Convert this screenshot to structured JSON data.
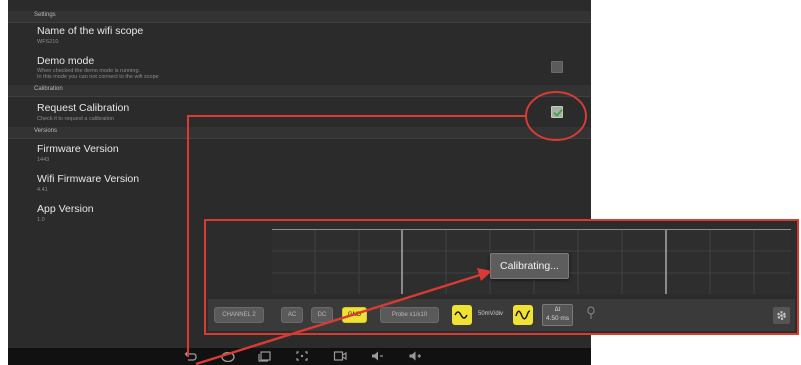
{
  "settings": {
    "sections": {
      "settings": "Settings",
      "calibration": "Calibration",
      "versions": "Versions"
    },
    "items": {
      "wifi_scope_name": {
        "title": "Name of the wifi scope",
        "value": "WFS210"
      },
      "demo_mode": {
        "title": "Demo mode",
        "desc1": "When checked the demo mode is running.",
        "desc2": "In this mode you can not connect to the wifi scope",
        "checked": false
      },
      "request_calibration": {
        "title": "Request Calibration",
        "desc": "Check it to request a calibration",
        "checked": true
      },
      "firmware_version": {
        "title": "Firmware Version",
        "value": "1443"
      },
      "wifi_firmware_version": {
        "title": "Wifi Firmware Version",
        "value": "4.41"
      },
      "app_version": {
        "title": "App Version",
        "value": "1.0"
      }
    }
  },
  "scope": {
    "toolbar": {
      "channel": "CHANNEL 2",
      "ac": "AC",
      "dc": "DC",
      "gnd": "GND",
      "probe": "Probe x1/x10",
      "volt_div": "50mV/div",
      "delta_t_label": "Δt",
      "delta_t_value": "4.50 ms"
    },
    "popup": "Calibrating..."
  },
  "colors": {
    "annotation_red": "#d63b34",
    "accent_yellow": "#f0e235",
    "check_green": "#3fa24a"
  },
  "icons": {
    "navbar": [
      "back-icon",
      "home-icon",
      "recent-apps-icon",
      "screenshot-icon",
      "camera-icon",
      "volume-down-icon",
      "volume-up-icon"
    ],
    "toolbar": [
      "sine-wave-icon",
      "sine-wave-icon",
      "trigger-icon",
      "gear-icon"
    ]
  }
}
